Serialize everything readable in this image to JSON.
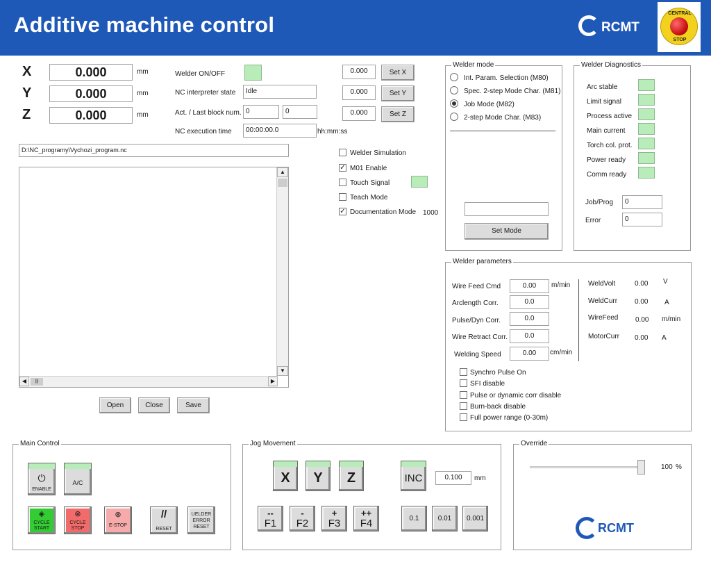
{
  "header": {
    "title": "Additive machine control",
    "logo_text": "RCMT",
    "stop_badge": {
      "line1": "CENTRAL",
      "line2": "STOP"
    }
  },
  "axes": [
    {
      "axis": "X",
      "value": "0.000",
      "unit": "mm",
      "set_value": "0.000",
      "set_label": "Set X"
    },
    {
      "axis": "Y",
      "value": "0.000",
      "unit": "mm",
      "set_value": "0.000",
      "set_label": "Set Y"
    },
    {
      "axis": "Z",
      "value": "0.000",
      "unit": "mm",
      "set_value": "0.000",
      "set_label": "Set Z"
    }
  ],
  "status": {
    "welder_onoff_label": "Welder ON/OFF",
    "nc_state_label": "NC interpreter state",
    "nc_state_value": "Idle",
    "block_label": "Act. / Last block num.",
    "block_act": "0",
    "block_last": "0",
    "exec_time_label": "NC execution time",
    "exec_time_value": "00:00:00.0",
    "exec_time_unit": "hh:mm:ss"
  },
  "program": {
    "path": "D:\\NC_programy\\Vychozi_program.nc",
    "open": "Open",
    "close": "Close",
    "save": "Save"
  },
  "options": {
    "welder_simulation": {
      "label": "Welder Simulation",
      "checked": false
    },
    "m01_enable": {
      "label": "M01 Enable",
      "checked": true
    },
    "touch_signal": {
      "label": "Touch Signal",
      "checked": false
    },
    "teach_mode": {
      "label": "Teach Mode",
      "checked": false
    },
    "documentation_mode": {
      "label": "Documentation Mode",
      "checked": true,
      "value": "1000"
    }
  },
  "welder_mode": {
    "title": "Welder mode",
    "options": [
      {
        "label": "Int. Param. Selection (M80)",
        "selected": false
      },
      {
        "label": "Spec. 2-step Mode Char. (M81)",
        "selected": false
      },
      {
        "label": "Job Mode (M82)",
        "selected": true
      },
      {
        "label": "2-step Mode Char. (M83)",
        "selected": false
      }
    ],
    "input_value": "",
    "set_mode": "Set Mode"
  },
  "diagnostics": {
    "title": "Welder Diagnostics",
    "items": [
      "Arc stable",
      "Limit signal",
      "Process active",
      "Main current",
      "Torch col. prot.",
      "Power ready",
      "Comm ready"
    ],
    "job_prog_label": "Job/Prog",
    "job_prog_value": "0",
    "error_label": "Error",
    "error_value": "0"
  },
  "welder_params": {
    "title": "Welder parameters",
    "inputs": [
      {
        "label": "Wire Feed Cmd",
        "value": "0.00",
        "unit": "m/min"
      },
      {
        "label": "Arclength Corr.",
        "value": "0.0",
        "unit": ""
      },
      {
        "label": "Pulse/Dyn Corr.",
        "value": "0.0",
        "unit": ""
      },
      {
        "label": "Wire Retract Corr.",
        "value": "0.0",
        "unit": ""
      },
      {
        "label": "Welding Speed",
        "value": "0.00",
        "unit": "cm/min"
      }
    ],
    "readouts": [
      {
        "label": "WeldVolt",
        "value": "0.00",
        "unit": "V"
      },
      {
        "label": "WeldCurr",
        "value": "0.00",
        "unit": "A"
      },
      {
        "label": "WireFeed",
        "value": "0.00",
        "unit": "m/min"
      },
      {
        "label": "MotorCurr",
        "value": "0.00",
        "unit": "A"
      }
    ],
    "checks": [
      {
        "label": "Synchro Pulse On",
        "checked": false
      },
      {
        "label": "SFI disable",
        "checked": false
      },
      {
        "label": "Pulse or dynamic corr disable",
        "checked": false
      },
      {
        "label": "Burn-back disable",
        "checked": false
      },
      {
        "label": "Full power range (0-30m)",
        "checked": false
      }
    ]
  },
  "main_control": {
    "title": "Main Control",
    "enable": "ENABLE",
    "ac": "A/C",
    "cycle_start": [
      "CYCLE",
      "START"
    ],
    "cycle_stop": [
      "CYCLE",
      "STOP"
    ],
    "estop": "E-STOP",
    "reset": "RESET",
    "welder_reset": [
      "UELDER",
      "ERROR",
      "RESET"
    ]
  },
  "jog": {
    "title": "Jog Movement",
    "axes": [
      "X",
      "Y",
      "Z"
    ],
    "inc": "INC",
    "inc_value": "0.100",
    "inc_unit": "mm",
    "f_buttons": [
      {
        "sym": "--",
        "key": "F1"
      },
      {
        "sym": "-",
        "key": "F2"
      },
      {
        "sym": "+",
        "key": "F3"
      },
      {
        "sym": "++",
        "key": "F4"
      }
    ],
    "steps": [
      "0.1",
      "0.01",
      "0.001"
    ]
  },
  "override": {
    "title": "Override",
    "value": "100",
    "unit": "%",
    "logo_text": "RCMT"
  },
  "colors": {
    "header": "#1f59b8",
    "led_green": "#b8ecb8",
    "cycle_start": "#33cc33",
    "cycle_stop": "#f26a6a",
    "estop": "#f7aaaa"
  }
}
